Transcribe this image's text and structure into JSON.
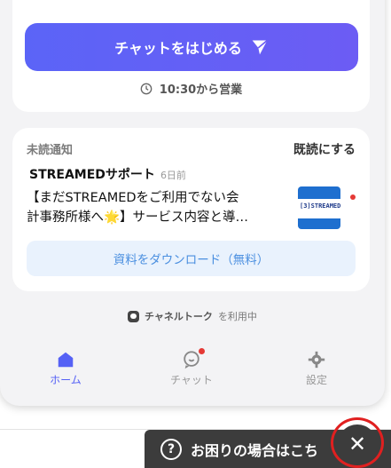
{
  "cta": {
    "label": "チャットをはじめる"
  },
  "hours": {
    "text": "10:30から営業"
  },
  "notice": {
    "unread_label": "未読通知",
    "mark_read_label": "既読にする",
    "sender": "STREAMEDサポート",
    "time": "6日前",
    "message_line1": "【まだSTREAMEDをご利用でない会",
    "message_line2": "計事務所様へ🌟】サービス内容と導…",
    "thumbnail_text": "[3]STREAMED",
    "download_label": "資料をダウンロード（無料）"
  },
  "channel": {
    "brand": "チャネルトーク",
    "suffix": "を利用中"
  },
  "nav": {
    "home": "ホーム",
    "chat": "チャット",
    "settings": "設定"
  },
  "help": {
    "label": "お困りの場合はこち"
  },
  "colors": {
    "accent": "#5561f5",
    "alert": "#e53935",
    "help_bg": "#3c3c3c"
  }
}
